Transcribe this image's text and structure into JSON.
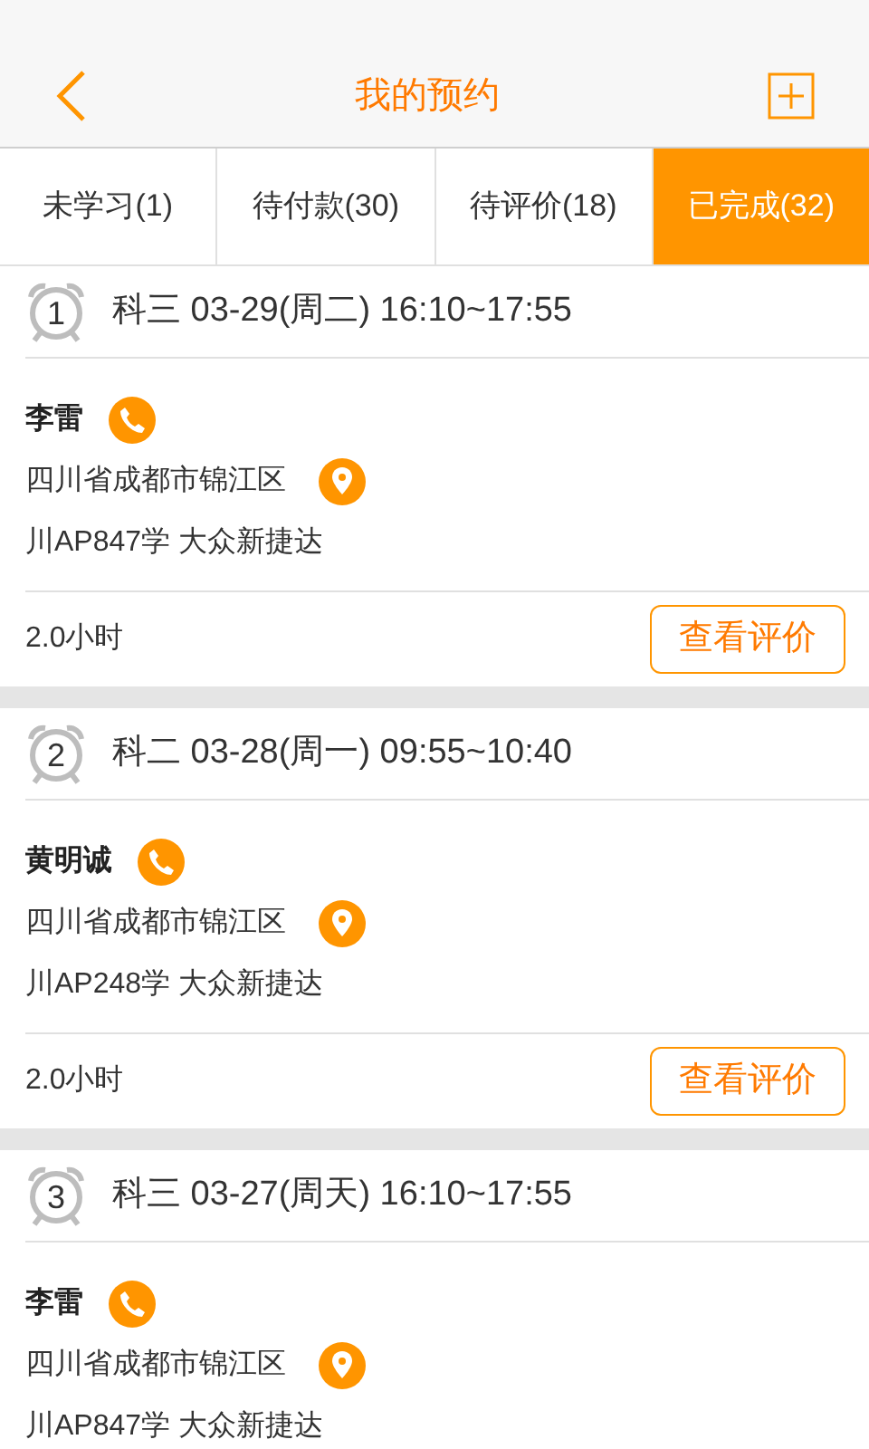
{
  "header": {
    "title": "我的预约"
  },
  "tabs": [
    {
      "label": "未学习(1)",
      "selected": false
    },
    {
      "label": "待付款(30)",
      "selected": false
    },
    {
      "label": "待评价(18)",
      "selected": false
    },
    {
      "label": "已完成(32)",
      "selected": true
    }
  ],
  "bookings": [
    {
      "number": "1",
      "title": "科三 03-29(周二) 16:10~17:55",
      "coach": "李雷",
      "address": "四川省成都市锦江区",
      "car": "川AP847学 大众新捷达",
      "duration": "2.0小时",
      "button": "查看评价"
    },
    {
      "number": "2",
      "title": "科二 03-28(周一) 09:55~10:40",
      "coach": "黄明诚",
      "address": "四川省成都市锦江区",
      "car": "川AP248学 大众新捷达",
      "duration": "2.0小时",
      "button": "查看评价"
    },
    {
      "number": "3",
      "title": "科三 03-27(周天) 16:10~17:55",
      "coach": "李雷",
      "address": "四川省成都市锦江区",
      "car": "川AP847学 大众新捷达"
    }
  ]
}
